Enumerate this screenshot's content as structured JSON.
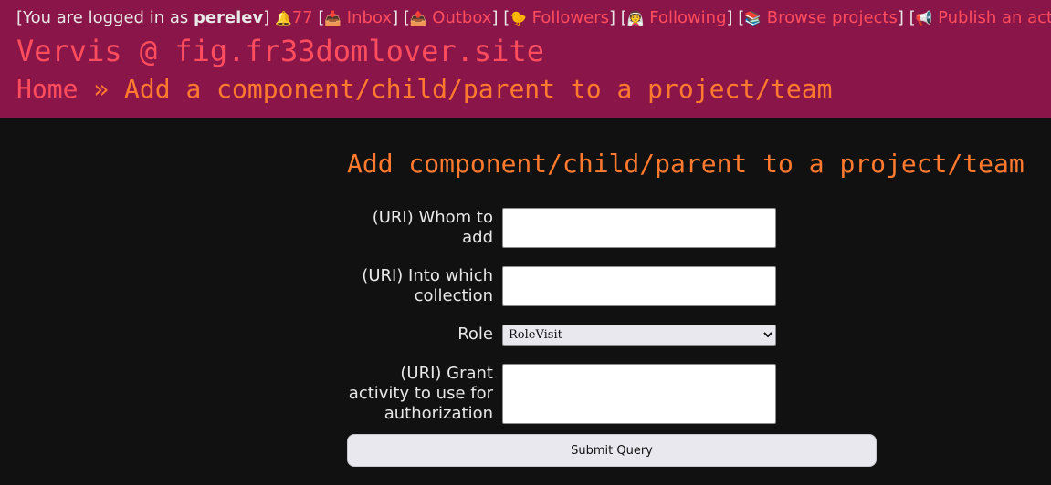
{
  "header": {
    "logged_in_prefix": "[You are logged in as ",
    "username": "perelev",
    "logged_in_suffix": "]",
    "notifications_icon": "bell-icon",
    "notifications_count": "77",
    "nav": [
      {
        "label": "Inbox",
        "icon": "inbox-tray-icon",
        "emoji": "📥"
      },
      {
        "label": "Outbox",
        "icon": "outbox-tray-icon",
        "emoji": "📤"
      },
      {
        "label": "Followers",
        "icon": "chick-icon",
        "emoji": "🐤"
      },
      {
        "label": "Following",
        "icon": "person-icon",
        "emoji": "👰"
      },
      {
        "label": "Browse projects",
        "icon": "books-icon",
        "emoji": "📚"
      },
      {
        "label": "Publish an activity",
        "icon": "megaphone-icon",
        "emoji": "📢"
      }
    ]
  },
  "site_title": "Vervis @ fig.fr33domlover.site",
  "breadcrumb": {
    "home": "Home",
    "separator": "»",
    "current": "Add a component/child/parent to a project/team"
  },
  "page_title": "Add component/child/parent to a project/team",
  "form": {
    "whom_label": "(URI) Whom to add",
    "whom_value": "",
    "collection_label": "(URI) Into which collection",
    "collection_value": "",
    "role_label": "Role",
    "role_selected": "RoleVisit",
    "grant_label": "(URI) Grant activity to use for authorization",
    "grant_value": "",
    "submit_label": "Submit Query"
  },
  "colors": {
    "header_bg": "#8a1548",
    "link": "#ff4d5e",
    "accent": "#ff7a2e",
    "page_bg": "#111111"
  }
}
